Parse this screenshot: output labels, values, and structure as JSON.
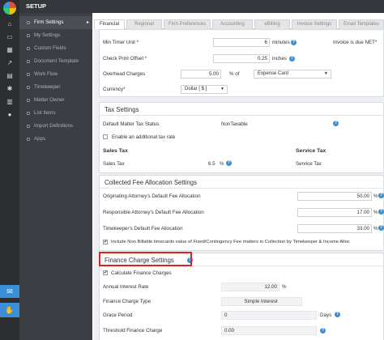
{
  "header": {
    "title": "SETUP"
  },
  "sidebar": {
    "items": [
      {
        "label": "Firm Settings",
        "active": true
      },
      {
        "label": "My Settings"
      },
      {
        "label": "Custom Fields"
      },
      {
        "label": "Document Template"
      },
      {
        "label": "Work Flow"
      },
      {
        "label": "Timekeeper"
      },
      {
        "label": "Matter Owner"
      },
      {
        "label": "List Items"
      },
      {
        "label": "Import Definitions"
      },
      {
        "label": "Apps"
      }
    ]
  },
  "tabs": [
    "Financial",
    "Regional",
    "Firm Preferences",
    "Accounting",
    "eBilling",
    "Invoice Settings",
    "Email Templates"
  ],
  "invoice": {
    "min_timer_label": "Min Timer Unit *",
    "min_timer_value": "6",
    "min_timer_unit": "minutes",
    "invoice_due_label": "Invoice is due NET*",
    "check_print_label": "Check Print Offset *",
    "check_print_value": "0.25",
    "check_print_unit": "inches",
    "overhead_label": "Overhead Charges",
    "overhead_value": "5.00",
    "overhead_unit": "% of",
    "overhead_select": "Expense Card",
    "currency_label": "Currency*",
    "currency_value": "Dollar [ $ ]"
  },
  "tax": {
    "title": "Tax Settings",
    "default_status_label": "Default Matter Tax Status",
    "default_status_value": "NonTaxable",
    "enable_label": "Enable an additional tax rate",
    "sales_heading": "Sales Tax",
    "sales_label": "Sales Tax",
    "sales_value": "6.5",
    "sales_unit": "%",
    "service_heading": "Service Tax",
    "service_label": "Service Tax"
  },
  "fee": {
    "title": "Collected Fee Allocation Settings",
    "rows": [
      {
        "label": "Originating Attorney's Default Fee Allocation",
        "value": "50.00",
        "unit": "%"
      },
      {
        "label": "Responsible Attorney's Default Fee Allocation",
        "value": "17.00",
        "unit": "%"
      },
      {
        "label": "Timekeeper's Default Fee Allocation",
        "value": "33.00",
        "unit": "%"
      }
    ],
    "include_label": "Include Non Billable timecards value of Fixed/Contingency Fee matters in Collection by Timekeeper & Income Alloc"
  },
  "finance": {
    "title": "Finance Charge Settings",
    "calc_label": "Calculate Finance Charges",
    "rate_label": "Annual Interest Rate",
    "rate_value": "12.00",
    "rate_unit": "%",
    "type_label": "Finance Charge Type",
    "type_value": "Simple Interest",
    "grace_label": "Grace Period",
    "grace_value": "0",
    "grace_unit": "Days",
    "threshold_label": "Threshold Finance Charge",
    "threshold_value": "0.00"
  },
  "icons": {
    "check": "✔",
    "help": "?",
    "chevron": "▼",
    "arrow": "▸"
  },
  "colors": {
    "accent": "#3a8fd6",
    "highlight": "#e02020",
    "rail": "#2b2d31",
    "sidebar": "#3b3e43"
  }
}
